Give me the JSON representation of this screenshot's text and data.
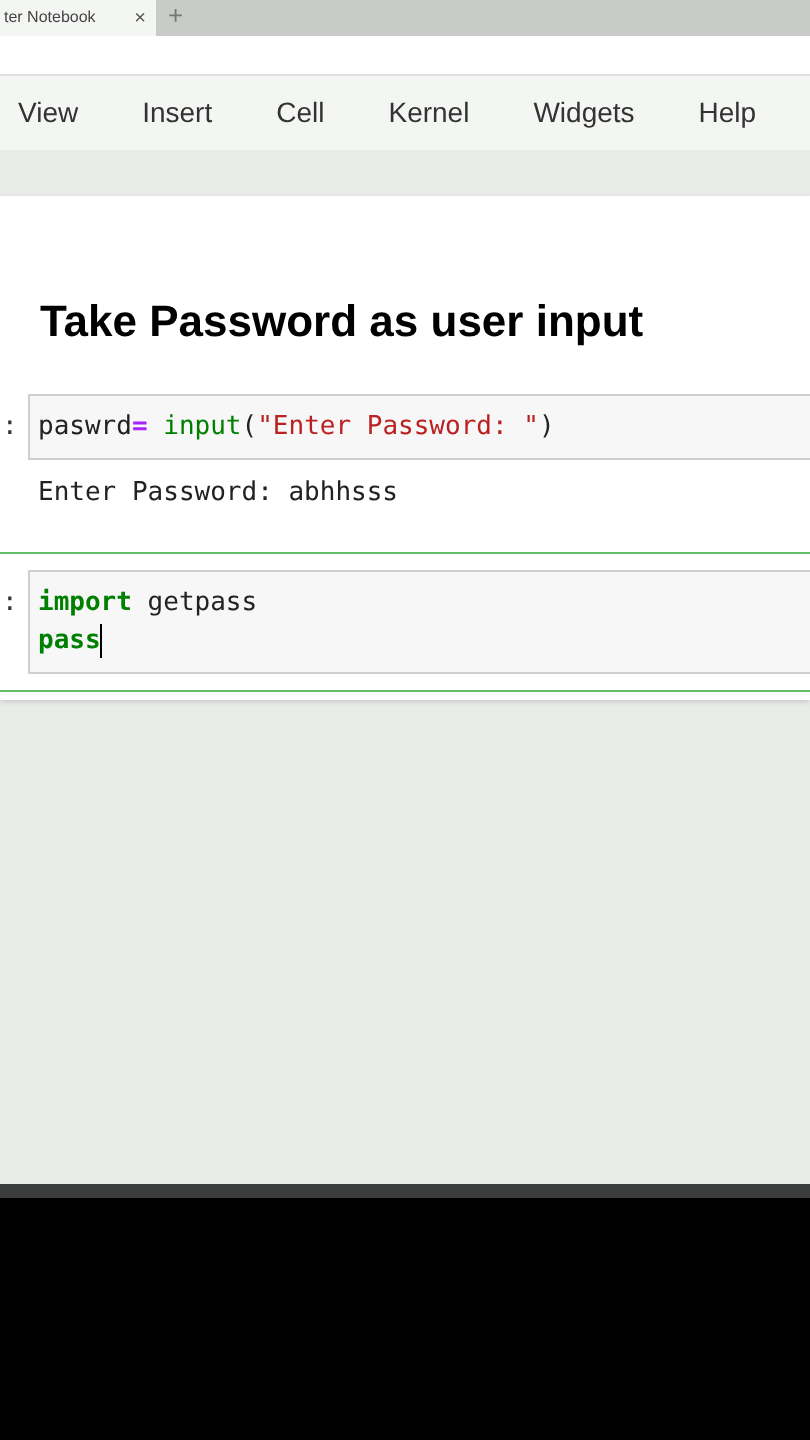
{
  "browser_tab": {
    "title": "ter Notebook",
    "close": "×",
    "new_tab": "+"
  },
  "menu": [
    "View",
    "Insert",
    "Cell",
    "Kernel",
    "Widgets",
    "Help"
  ],
  "heading": "Take Password as user input",
  "cells": [
    {
      "prompt": ":",
      "selected": false,
      "lines": [
        [
          {
            "kind": "name",
            "text": "paswrd"
          },
          {
            "kind": "operator",
            "text": "="
          },
          {
            "kind": "builtin",
            "text": " input"
          },
          {
            "kind": "name",
            "text": "("
          },
          {
            "kind": "string",
            "text": "\"Enter Password: \""
          },
          {
            "kind": "name",
            "text": ")"
          }
        ]
      ],
      "output": "Enter Password: abhhsss"
    },
    {
      "prompt": ":",
      "selected": true,
      "lines": [
        [
          {
            "kind": "keyword",
            "text": "import"
          },
          {
            "kind": "name",
            "text": " getpass"
          }
        ],
        [
          {
            "kind": "keyword",
            "text": "pass"
          }
        ]
      ]
    }
  ]
}
